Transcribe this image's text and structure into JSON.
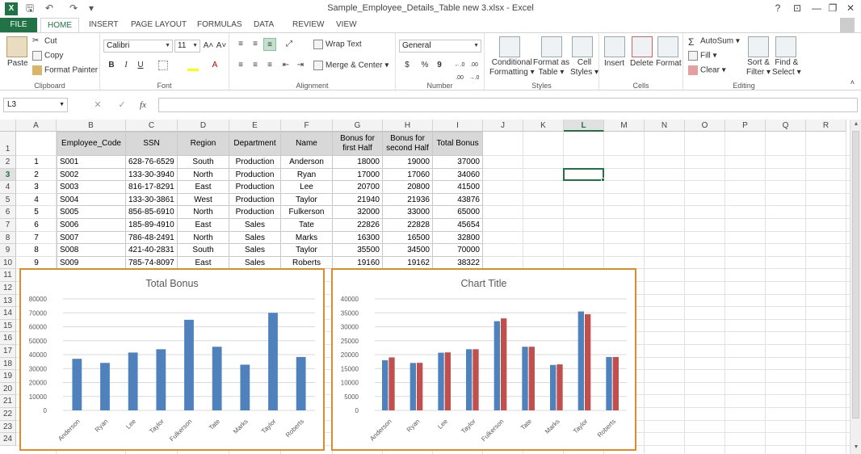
{
  "window": {
    "title": "Sample_Employee_Details_Table new 3.xlsx - Excel",
    "app_icon": "X",
    "help": "?",
    "ribbon_display": "⊡",
    "minimize": "—",
    "restore": "❐",
    "close": "✕"
  },
  "quick_access": {
    "save": "🖫",
    "undo": "↶",
    "redo": "↷",
    "customize": "▾"
  },
  "tabs": [
    {
      "label": "FILE"
    },
    {
      "label": "HOME"
    },
    {
      "label": "INSERT"
    },
    {
      "label": "PAGE LAYOUT"
    },
    {
      "label": "FORMULAS"
    },
    {
      "label": "DATA"
    },
    {
      "label": "REVIEW"
    },
    {
      "label": "VIEW"
    }
  ],
  "ribbon": {
    "clipboard": {
      "label": "Clipboard",
      "paste": "Paste",
      "cut": "Cut",
      "copy": "Copy",
      "format_painter": "Format Painter"
    },
    "font": {
      "label": "Font",
      "font_name": "Calibri",
      "font_size": "11",
      "grow": "A˄",
      "shrink": "A˅",
      "bold": "B",
      "italic": "I",
      "underline": "U"
    },
    "alignment": {
      "label": "Alignment",
      "wrap_text": "Wrap Text",
      "merge_center": "Merge & Center"
    },
    "number": {
      "label": "Number",
      "format": "General",
      "currency": "$",
      "percent": "%",
      "comma": "9",
      "inc_dec": "←.0 .00",
      "dec_dec": ".00 →.0"
    },
    "styles": {
      "label": "Styles",
      "conditional_formatting": [
        "Conditional",
        "Formatting"
      ],
      "format_as_table": [
        "Format as",
        "Table"
      ],
      "cell_styles": [
        "Cell",
        "Styles"
      ]
    },
    "cells": {
      "label": "Cells",
      "insert": "Insert",
      "delete": "Delete",
      "format": "Format"
    },
    "editing": {
      "label": "Editing",
      "autosum": "AutoSum",
      "fill": "Fill",
      "clear": "Clear",
      "sort_filter": [
        "Sort &",
        "Filter"
      ],
      "find_select": [
        "Find &",
        "Select"
      ]
    }
  },
  "formula_bar": {
    "name_box": "L3",
    "cancel": "✕",
    "enter": "✓",
    "fx": "fx",
    "value": ""
  },
  "columns": [
    "A",
    "B",
    "C",
    "D",
    "E",
    "F",
    "G",
    "H",
    "I",
    "J",
    "K",
    "L",
    "M",
    "N",
    "O",
    "P",
    "Q",
    "R"
  ],
  "rows": [
    "1",
    "2",
    "3",
    "4",
    "5",
    "6",
    "7",
    "8",
    "9",
    "10",
    "11",
    "12",
    "13",
    "14",
    "15",
    "16",
    "17",
    "18",
    "19",
    "20",
    "21",
    "22",
    "23",
    "24"
  ],
  "selected_cell": {
    "column": "L",
    "row": "3"
  },
  "table": {
    "headers": [
      "Employee_Code",
      "SSN",
      "Region",
      "Department",
      "Name",
      "Bonus for first Half",
      "Bonus for second Half",
      "Total Bonus"
    ],
    "rows": [
      [
        "1",
        "S001",
        "628-76-6529",
        "South",
        "Production",
        "Anderson",
        "18000",
        "19000",
        "37000"
      ],
      [
        "2",
        "S002",
        "133-30-3940",
        "North",
        "Production",
        "Ryan",
        "17000",
        "17060",
        "34060"
      ],
      [
        "3",
        "S003",
        "816-17-8291",
        "East",
        "Production",
        "Lee",
        "20700",
        "20800",
        "41500"
      ],
      [
        "4",
        "S004",
        "133-30-3861",
        "West",
        "Production",
        "Taylor",
        "21940",
        "21936",
        "43876"
      ],
      [
        "5",
        "S005",
        "856-85-6910",
        "North",
        "Production",
        "Fulkerson",
        "32000",
        "33000",
        "65000"
      ],
      [
        "6",
        "S006",
        "185-89-4910",
        "East",
        "Sales",
        "Tate",
        "22826",
        "22828",
        "45654"
      ],
      [
        "7",
        "S007",
        "786-48-2491",
        "North",
        "Sales",
        "Marks",
        "16300",
        "16500",
        "32800"
      ],
      [
        "8",
        "S008",
        "421-40-2831",
        "South",
        "Sales",
        "Taylor",
        "35500",
        "34500",
        "70000"
      ],
      [
        "9",
        "S009",
        "785-74-8097",
        "East",
        "Sales",
        "Roberts",
        "19160",
        "19162",
        "38322"
      ]
    ]
  },
  "colors": {
    "excel_green": "#217346",
    "bar_blue": "#4f81bd",
    "bar_red": "#c0504d",
    "chart_border": "#e08a2c"
  },
  "chart_data": [
    {
      "type": "bar",
      "title": "Total Bonus",
      "categories": [
        "Anderson",
        "Ryan",
        "Lee",
        "Taylor",
        "Fulkerson",
        "Tate",
        "Marks",
        "Taylor",
        "Roberts"
      ],
      "series": [
        {
          "values": [
            37000,
            34060,
            41500,
            43876,
            65000,
            45654,
            32800,
            70000,
            38322
          ],
          "color": "#4f81bd"
        }
      ],
      "ylim": [
        0,
        80000
      ],
      "yticks": [
        "0",
        "10000",
        "20000",
        "30000",
        "40000",
        "50000",
        "60000",
        "70000",
        "80000"
      ],
      "grid": true
    },
    {
      "type": "bar",
      "title": "Chart Title",
      "categories": [
        "Anderson",
        "Ryan",
        "Lee",
        "Taylor",
        "Fulkerson",
        "Tate",
        "Marks",
        "Taylor",
        "Roberts"
      ],
      "series": [
        {
          "values": [
            18000,
            17000,
            20700,
            21940,
            32000,
            22826,
            16300,
            35500,
            19160
          ],
          "color": "#4f81bd"
        },
        {
          "values": [
            19000,
            17060,
            20800,
            21936,
            33000,
            22828,
            16500,
            34500,
            19162
          ],
          "color": "#c0504d"
        }
      ],
      "ylim": [
        0,
        40000
      ],
      "yticks": [
        "0",
        "5000",
        "10000",
        "15000",
        "20000",
        "25000",
        "30000",
        "35000",
        "40000"
      ],
      "grid": true
    }
  ]
}
